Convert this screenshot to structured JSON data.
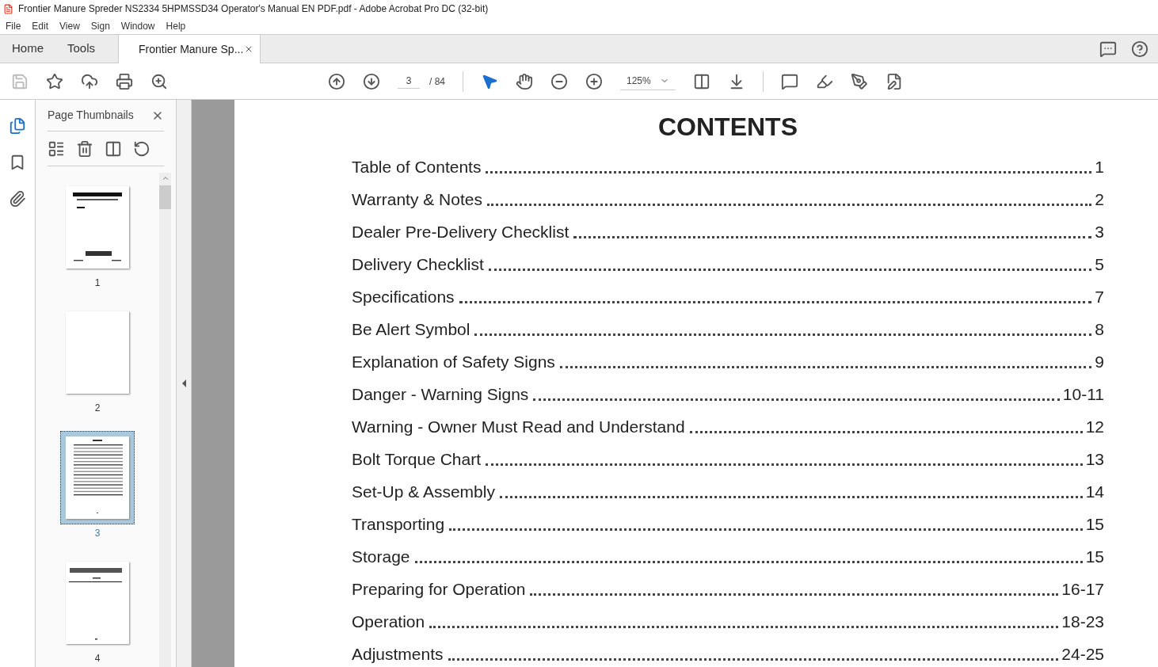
{
  "window": {
    "title": "Frontier Manure Spreder NS2334 5HPMSSD34 Operator's Manual EN PDF.pdf - Adobe Acrobat Pro DC (32-bit)"
  },
  "menu": [
    "File",
    "Edit",
    "View",
    "Sign",
    "Window",
    "Help"
  ],
  "tabs": [
    {
      "label": "Home",
      "selected": false,
      "kind": "nav"
    },
    {
      "label": "Tools",
      "selected": false,
      "kind": "nav"
    },
    {
      "label": "Frontier Manure Sp...",
      "selected": true,
      "kind": "doc"
    }
  ],
  "toolbar": {
    "page_number": "3",
    "page_total": "/ 84",
    "zoom": "125%"
  },
  "sidebar": {
    "title": "Page Thumbnails",
    "thumbnails": [
      {
        "label": "1",
        "selected": false,
        "kind": "cover"
      },
      {
        "label": "2",
        "selected": false,
        "kind": "blank"
      },
      {
        "label": "3",
        "selected": true,
        "kind": "contents"
      },
      {
        "label": "4",
        "selected": false,
        "kind": "text"
      }
    ]
  },
  "document": {
    "heading": "CONTENTS",
    "entries": [
      {
        "title": "Table of Contents",
        "page": "1"
      },
      {
        "title": "Warranty & Notes",
        "page": "2"
      },
      {
        "title": "Dealer Pre-Delivery Checklist",
        "page": "3"
      },
      {
        "title": "Delivery Checklist",
        "page": "5"
      },
      {
        "title": "Specifications",
        "page": "7"
      },
      {
        "title": "Be Alert Symbol",
        "page": "8"
      },
      {
        "title": "Explanation of Safety Signs",
        "page": "9"
      },
      {
        "title": "Danger - Warning Signs",
        "page": "10-11"
      },
      {
        "title": "Warning - Owner Must Read and Understand",
        "page": "12"
      },
      {
        "title": "Bolt Torque Chart",
        "page": "13"
      },
      {
        "title": "Set-Up & Assembly",
        "page": "14"
      },
      {
        "title": "Transporting",
        "page": "15"
      },
      {
        "title": "Storage",
        "page": "15"
      },
      {
        "title": "Preparing for Operation",
        "page": "16-17"
      },
      {
        "title": "Operation",
        "page": "18-23"
      },
      {
        "title": "Adjustments",
        "page": "24-25"
      }
    ]
  }
}
